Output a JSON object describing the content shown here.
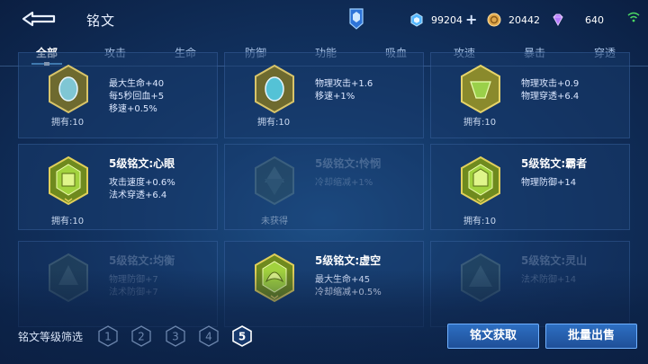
{
  "header": {
    "title": "铭文",
    "back_icon": "back-arrow-icon",
    "currencies": [
      {
        "name": "coupon",
        "icon": "coupon-icon",
        "value": "99204",
        "color": "#53b6ff"
      },
      {
        "name": "gold",
        "icon": "gold-coin-icon",
        "value": "20442",
        "color": "#e0a84a"
      },
      {
        "name": "gem",
        "icon": "gem-icon",
        "value": "640",
        "color": "#b57aff"
      }
    ]
  },
  "tabs": [
    {
      "label": "全部",
      "active": true
    },
    {
      "label": "攻击"
    },
    {
      "label": "生命"
    },
    {
      "label": "防御"
    },
    {
      "label": "功能"
    },
    {
      "label": "吸血"
    },
    {
      "label": "攻速"
    },
    {
      "label": "暴击"
    },
    {
      "label": "穿透"
    }
  ],
  "cards": [
    {
      "name": "",
      "stats": [
        "最大生命+40",
        "每5秒回血+5",
        "移速+0.5%"
      ],
      "owned": "拥有:10",
      "acquired": true
    },
    {
      "name": "",
      "stats": [
        "物理攻击+1.6",
        "移速+1%"
      ],
      "owned": "拥有:10",
      "acquired": true
    },
    {
      "name": "",
      "stats": [
        "物理攻击+0.9",
        "物理穿透+6.4"
      ],
      "owned": "拥有:10",
      "acquired": true
    },
    {
      "name": "5级铭文:心眼",
      "stats": [
        "攻击速度+0.6%",
        "法术穿透+6.4"
      ],
      "owned": "拥有:10",
      "acquired": true
    },
    {
      "name": "5级铭文:怜悯",
      "stats": [
        "冷却缩减+1%"
      ],
      "owned": "未获得",
      "acquired": false
    },
    {
      "name": "5级铭文:霸者",
      "stats": [
        "物理防御+14"
      ],
      "owned": "拥有:10",
      "acquired": true
    },
    {
      "name": "5级铭文:均衡",
      "stats": [
        "物理防御+7",
        "法术防御+7"
      ],
      "owned": "",
      "acquired": false
    },
    {
      "name": "5级铭文:虚空",
      "stats": [
        "最大生命+45",
        "冷却缩减+0.5%"
      ],
      "owned": "",
      "acquired": true
    },
    {
      "name": "5级铭文:灵山",
      "stats": [
        "法术防御+14"
      ],
      "owned": "",
      "acquired": false
    }
  ],
  "filter": {
    "label": "铭文等级筛选",
    "levels": [
      "1",
      "2",
      "3",
      "4",
      "5"
    ],
    "selected": "5"
  },
  "buttons": {
    "get": "铭文获取",
    "sell": "批量出售"
  }
}
